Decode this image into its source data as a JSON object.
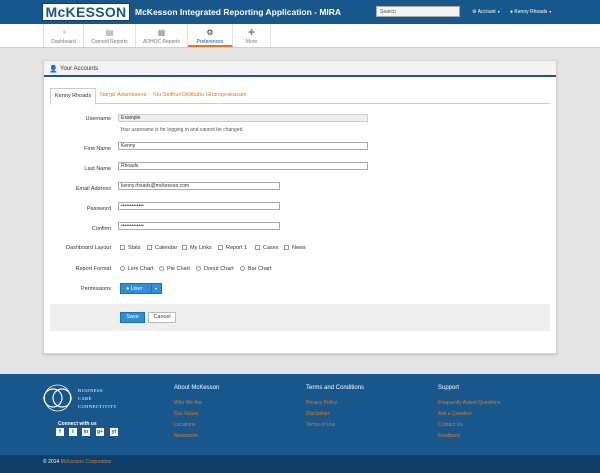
{
  "header": {
    "logo": "McKESSON",
    "app_title": "McKesson Integrated Reporting Application - MIRA",
    "search_placeholder": "Search",
    "account_label": "Account",
    "user_name": "Kenny Rhoads"
  },
  "nav": {
    "items": [
      {
        "label": "Dashboard",
        "icon": "dashboard-icon"
      },
      {
        "label": "Canned Reports",
        "icon": "canned-reports-icon"
      },
      {
        "label": "ADHOC Reports",
        "icon": "adhoc-reports-icon"
      },
      {
        "label": "Preferences",
        "icon": "gear-icon",
        "active": true
      },
      {
        "label": "More",
        "icon": "plus-icon"
      }
    ]
  },
  "panel": {
    "title": "Your Accounts",
    "tabs": [
      "Kenny Rhoads",
      "Nargiz Adambaeva",
      "Stu Selthun",
      "Dilliibabu Ghanaprakasam"
    ]
  },
  "form": {
    "username_label": "Username",
    "username_value": "Example",
    "username_help": "Your username is for logging in and cannot be changed.",
    "first_name_label": "First Name",
    "first_name_value": "Kenny",
    "last_name_label": "Last Name",
    "last_name_value": "Rhoads",
    "email_label": "Email Address",
    "email_value": "kenny.rhoads@mckesson.com",
    "password_label": "Password",
    "password_value": "•••••••••••••",
    "confirm_label": "Confirm",
    "confirm_value": "•••••••••••••",
    "dashboard_layout_label": "Dashboard Layout",
    "dashboard_options": [
      "Stats",
      "Calendar",
      "My Links",
      "Report 1",
      "Cases",
      "News"
    ],
    "report_format_label": "Report Format",
    "report_formats": [
      "Line Chart",
      "Pie Chart",
      "Donut Chart",
      "Bar Chart"
    ],
    "permissions_label": "Permissions",
    "permissions_value": "User",
    "save_label": "Save",
    "cancel_label": "Cancel"
  },
  "footer": {
    "tagline": [
      "BUSINESS",
      "CARE",
      "CONNECTIVITY"
    ],
    "connect_label": "Connect with us",
    "social": [
      "f",
      "t",
      "in",
      "g+",
      "yt"
    ],
    "about": {
      "heading": "About McKesson",
      "links": [
        "Who We Are",
        "Our Values",
        "Locations",
        "Newsroom"
      ]
    },
    "terms": {
      "heading": "Terms and Conditions",
      "links": [
        "Privacy Policy",
        "Disclaimer",
        "Terms of Use"
      ]
    },
    "support": {
      "heading": "Support",
      "links": [
        "Frequently Asked Questions",
        "Ask a Question",
        "Contact Us",
        "Feedback"
      ]
    },
    "copyright_prefix": "© 2014",
    "copyright_company": "McKesson Corporation"
  },
  "colors": {
    "brand": "#17578c",
    "accent": "#e87722",
    "button": "#2d8fd5"
  }
}
